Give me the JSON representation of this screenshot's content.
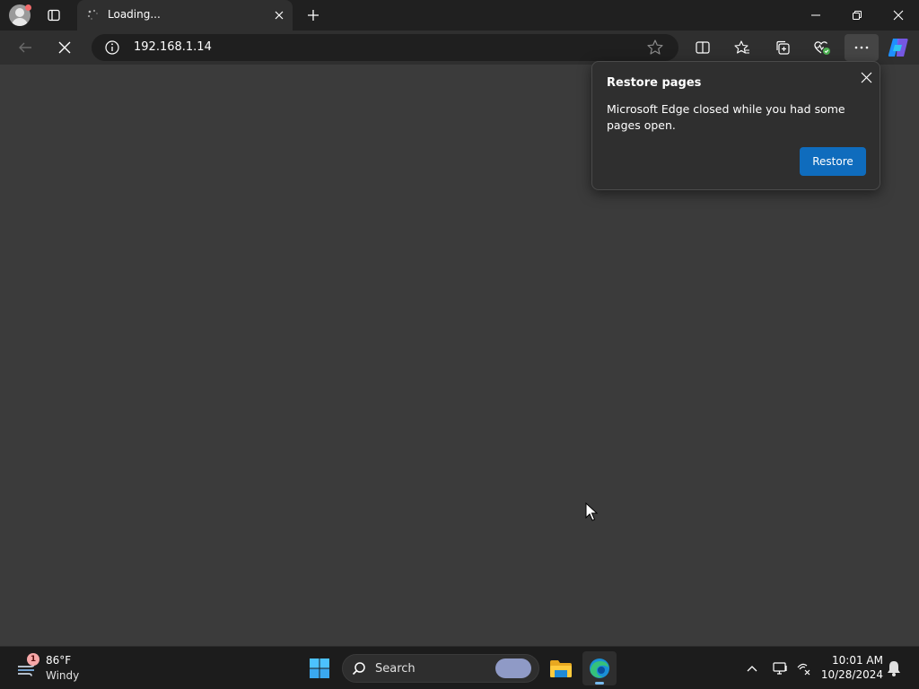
{
  "browser": {
    "tab": {
      "title": "Loading..."
    },
    "address": {
      "url": "192.168.1.14"
    }
  },
  "popup": {
    "title": "Restore pages",
    "message": "Microsoft Edge closed while you had some pages open.",
    "restore_label": "Restore"
  },
  "taskbar": {
    "weather": {
      "temperature": "86°F",
      "condition": "Windy",
      "badge": "1"
    },
    "search_label": "Search",
    "clock": {
      "time": "10:01 AM",
      "date": "10/28/2024"
    }
  },
  "colors": {
    "accent": "#0f6cbd",
    "content_bg": "#3b3b3b",
    "chrome_bg": "#2f2f2f"
  },
  "icons": {
    "tab_strip": [
      "profile-avatar-icon",
      "tab-actions-icon",
      "loading-spinner-icon",
      "close-icon",
      "plus-icon"
    ],
    "window": [
      "minimize-icon",
      "restore-icon",
      "close-icon"
    ],
    "toolbar": [
      "back-arrow-icon",
      "stop-icon",
      "info-icon",
      "star-icon",
      "split-screen-icon",
      "favorites-icon",
      "collections-icon",
      "browser-essentials-icon",
      "more-icon",
      "copilot-icon"
    ],
    "taskbar": [
      "weather-icon",
      "windows-start-icon",
      "search-icon",
      "file-explorer-icon",
      "edge-icon",
      "chevron-up-icon",
      "display-icon",
      "network-icon",
      "notification-bell-icon"
    ]
  }
}
